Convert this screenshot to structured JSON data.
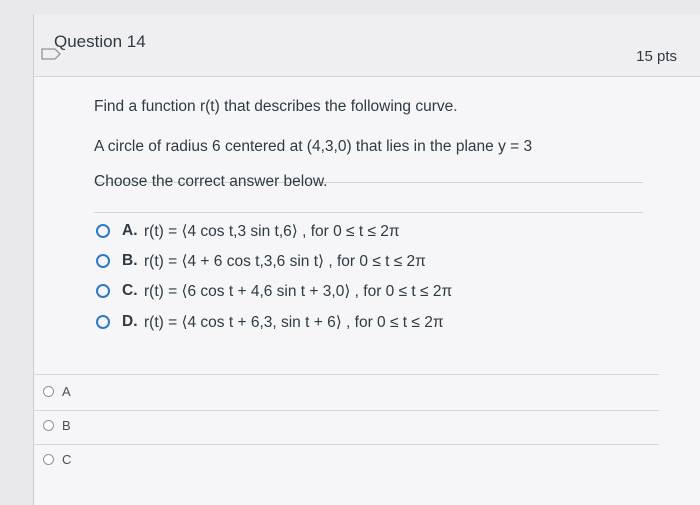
{
  "question": {
    "title": "Question 14",
    "points": "15 pts",
    "prompt": "Find a function r(t) that describes the following curve.",
    "description": "A circle of radius 6 centered at (4,3,0) that lies in the plane y = 3",
    "instruction": "Choose the correct answer below."
  },
  "choices": [
    {
      "letter": "A.",
      "text": "r(t) = ⟨4 cos t,3 sin t,6⟩ , for 0 ≤ t ≤ 2π"
    },
    {
      "letter": "B.",
      "text": "r(t) = ⟨4 + 6 cos  t,3,6 sin  t⟩ , for 0 ≤ t ≤ 2π"
    },
    {
      "letter": "C.",
      "text": "r(t) = ⟨6 cos t + 4,6 sin t + 3,0⟩ , for 0 ≤ t ≤ 2π"
    },
    {
      "letter": "D.",
      "text": "r(t) = ⟨4 cos t + 6,3, sin t + 6⟩ , for 0 ≤ t ≤ 2π"
    }
  ],
  "answers": [
    {
      "label": "A"
    },
    {
      "label": "B"
    },
    {
      "label": "C"
    }
  ],
  "colors": {
    "accent": "#2f79c9",
    "text": "#2d3b45"
  }
}
